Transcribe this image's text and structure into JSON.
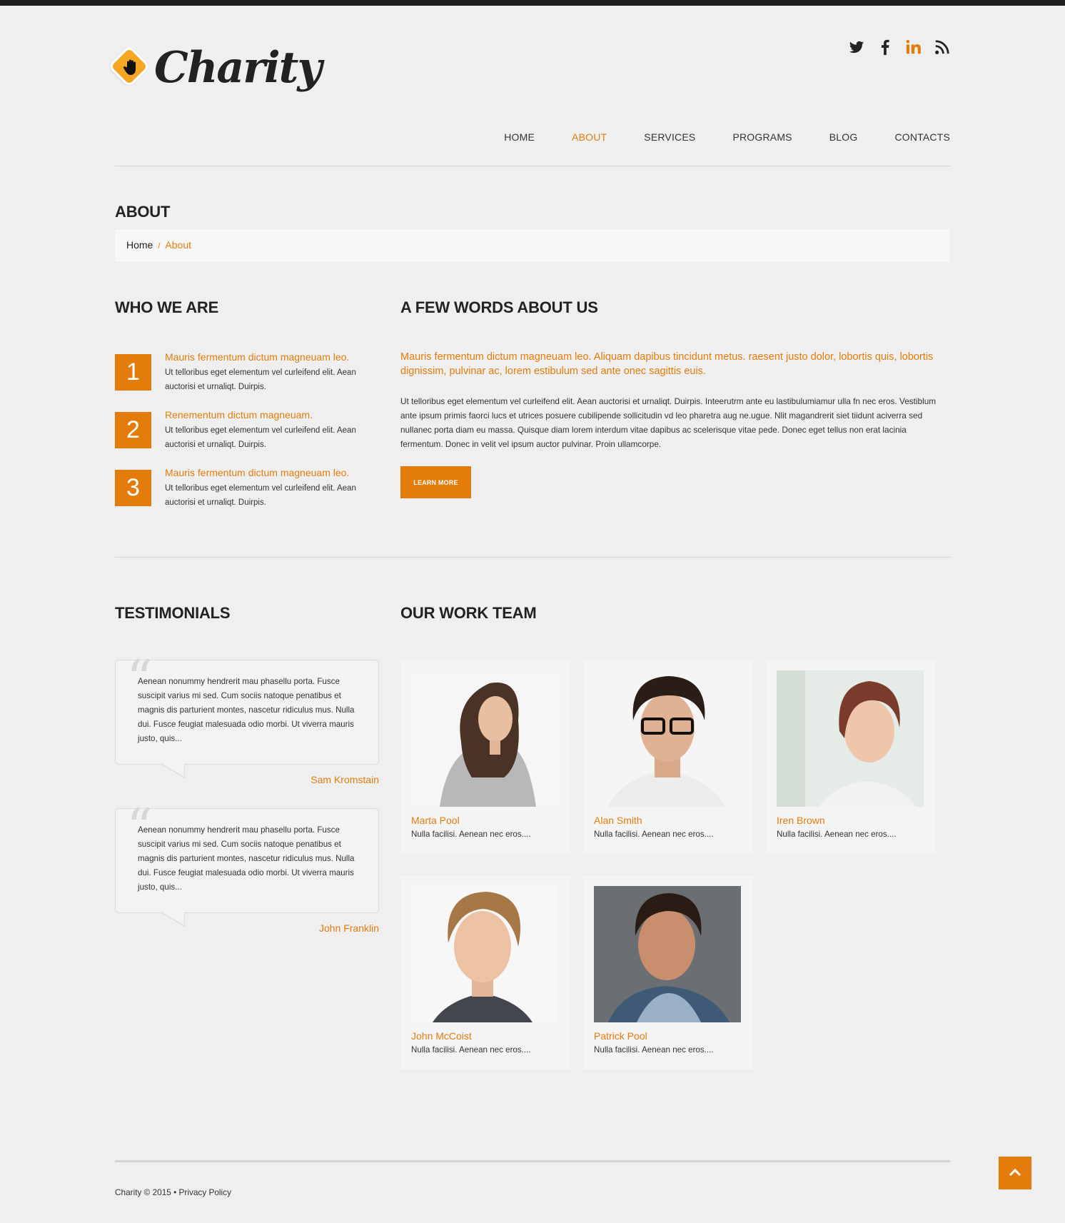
{
  "brand": {
    "logo_text": "Charity"
  },
  "social": [
    {
      "icon": "twitter-icon"
    },
    {
      "icon": "facebook-icon"
    },
    {
      "icon": "linkedin-icon"
    },
    {
      "icon": "rss-icon"
    }
  ],
  "nav": [
    "HOME",
    "ABOUT",
    "SERVICES",
    "PROGRAMS",
    "BLOG",
    "CONTACTS"
  ],
  "nav_active": "ABOUT",
  "page": {
    "title": "ABOUT"
  },
  "breadcrumb": {
    "home": "Home",
    "separator": "/",
    "current": "About"
  },
  "who": {
    "title": "WHO WE ARE",
    "items": [
      {
        "num": "1",
        "head": "Mauris fermentum dictum magneuam leo.",
        "text": "Ut telloribus eget elementum vel curleifend elit. Aean auctorisi et urnaliqt. Duirpis."
      },
      {
        "num": "2",
        "head": "Renementum dictum magneuam.",
        "text": "Ut telloribus eget elementum vel curleifend elit. Aean auctorisi et urnaliqt. Duirpis."
      },
      {
        "num": "3",
        "head": "Mauris fermentum dictum magneuam leo.",
        "text": "Ut telloribus eget elementum vel curleifend elit. Aean auctorisi et urnaliqt. Duirpis."
      }
    ]
  },
  "about": {
    "title": "A FEW WORDS ABOUT US",
    "lead": "Mauris fermentum dictum magneuam leo. Aliquam dapibus tincidunt metus. raesent justo dolor, lobortis quis, lobortis dignissim, pulvinar ac, lorem estibulum sed ante onec sagittis euis.",
    "body": "Ut telloribus eget elementum vel curleifend elit. Aean auctorisi et urnaliqt. Duirpis. Inteerutrm ante eu lastibulumiamur ulla fn nec eros. Vestiblum ante ipsum primis faorci lucs et utrices posuere cubilipende sollicitudin vd leo pharetra aug ne.ugue. Nlit magandrerit siet tiidunt aciverra sed nullanec porta diam eu massa. Quisque diam lorem interdum vitae dapibus ac scelerisque vitae pede. Donec eget tellus non erat lacinia fermentum. Donec in velit vel ipsum auctor pulvinar. Proin ullamcorpe.",
    "button": "LEARN MORE"
  },
  "testimonials": {
    "title": "TESTIMONIALS",
    "items": [
      {
        "text": "Aenean nonummy hendrerit mau phasellu porta. Fusce suscipit varius mi sed. Cum sociis natoque penatibus et magnis dis parturient montes, nascetur ridiculus mus. Nulla dui. Fusce feugiat malesuada odio morbi. Ut viverra mauris justo, quis...",
        "author": "Sam Kromstain"
      },
      {
        "text": "Aenean nonummy hendrerit mau phasellu porta. Fusce suscipit varius mi sed. Cum sociis natoque penatibus et magnis dis parturient montes, nascetur ridiculus mus. Nulla dui. Fusce feugiat malesuada odio morbi. Ut viverra mauris justo, quis...",
        "author": "John Franklin"
      }
    ]
  },
  "team": {
    "title": "OUR WORK TEAM",
    "members": [
      {
        "name": "Marta Pool",
        "desc": "Nulla facilisi. Aenean nec eros...."
      },
      {
        "name": "Alan Smith",
        "desc": "Nulla facilisi. Aenean nec eros...."
      },
      {
        "name": "Iren Brown",
        "desc": "Nulla facilisi. Aenean nec eros...."
      },
      {
        "name": "John McCoist",
        "desc": "Nulla facilisi. Aenean nec eros...."
      },
      {
        "name": "Patrick Pool",
        "desc": "Nulla facilisi. Aenean nec eros...."
      }
    ]
  },
  "footer": {
    "text": "Charity © 2015 • Privacy Policy"
  },
  "colors": {
    "accent": "#e47c0c",
    "background": "#efefef",
    "topbar": "#1f1f1f"
  }
}
